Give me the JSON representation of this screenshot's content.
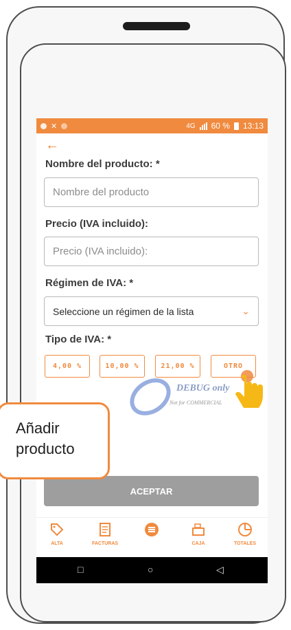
{
  "status_bar": {
    "network": "4G",
    "battery": "60 %",
    "time": "13:13"
  },
  "form": {
    "back_icon": "arrow-left-icon",
    "name_label": "Nombre del producto: *",
    "name_placeholder": "Nombre del producto",
    "price_label": "Precio (IVA incluido):",
    "price_placeholder": "Precio (IVA incluido):",
    "regime_label": "Régimen de IVA: *",
    "regime_selected": "Seleccione un régimen de la lista",
    "type_label": "Tipo de IVA: *",
    "iva_options": [
      "4,00 %",
      "10,00 %",
      "21,00 %",
      "OTRO"
    ],
    "accept_label": "ACEPTAR"
  },
  "nav": {
    "items": [
      {
        "label": "ALTA",
        "icon": "tag-icon"
      },
      {
        "label": "FACTURAS",
        "icon": "invoice-icon"
      },
      {
        "label": "",
        "icon": "menu-icon"
      },
      {
        "label": "CAJA",
        "icon": "cash-register-icon"
      },
      {
        "label": "TOTALES",
        "icon": "pie-chart-icon"
      }
    ]
  },
  "watermark": {
    "title": "DEBUG only",
    "subtitle": "Not for COMMERCIAL"
  },
  "callout": {
    "line1": "Añadir",
    "line2": "producto"
  },
  "colors": {
    "accent": "#f08a3e",
    "button_disabled": "#9e9e9e"
  }
}
